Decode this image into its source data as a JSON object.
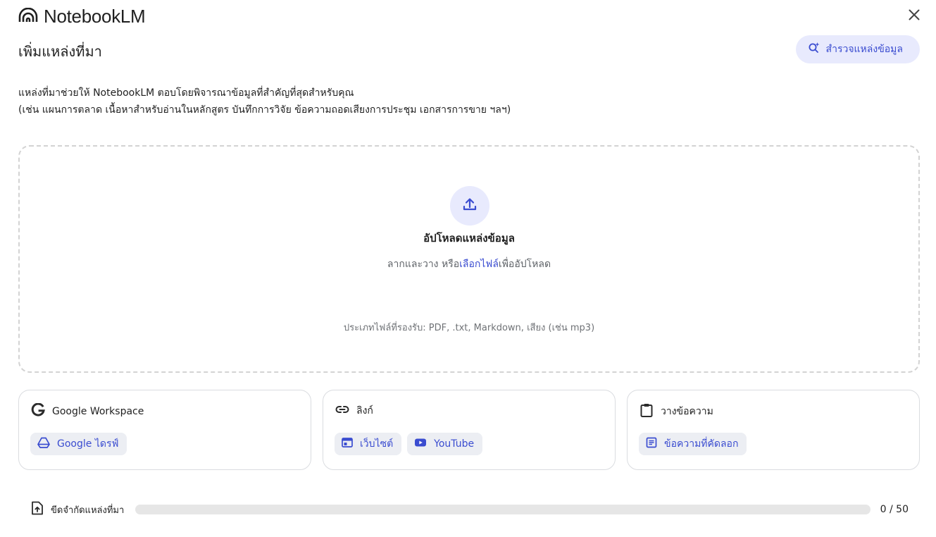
{
  "header": {
    "app_name": "NotebookLM",
    "title": "เพิ่มแหล่งที่มา",
    "explore_label": "สำรวจแหล่งข้อมูล"
  },
  "description": {
    "line1": "แหล่งที่มาช่วยให้ NotebookLM ตอบโดยพิจารณาข้อมูลที่สำคัญที่สุดสำหรับคุณ",
    "line2": "(เช่น แผนการตลาด เนื้อหาสำหรับอ่านในหลักสูตร บันทึกการวิจัย ข้อความถอดเสียงการประชุม เอกสารการขาย ฯลฯ)"
  },
  "upload": {
    "title": "อัปโหลดแหล่งข้อมูล",
    "drag_text": "ลากและวาง หรือ",
    "choose_link": "เลือกไฟล์",
    "after_link": "เพื่ออัปโหลด",
    "supported": "ประเภทไฟล์ที่รองรับ: PDF, .txt, Markdown, เสียง (เช่น mp3)"
  },
  "cards": {
    "workspace": {
      "title": "Google Workspace",
      "chips": [
        "Google ไดรฟ์"
      ]
    },
    "link": {
      "title": "ลิงก์",
      "chips": [
        "เว็บไซต์",
        "YouTube"
      ]
    },
    "paste": {
      "title": "วางข้อความ",
      "chips": [
        "ข้อความที่คัดลอก"
      ]
    }
  },
  "footer": {
    "limit_label": "ขีดจำกัดแหล่งที่มา",
    "count": "0 / 50",
    "progress": 0
  },
  "icons": {
    "logo": "notebooklm-logo-icon",
    "close": "close-icon",
    "explore": "search-spark-icon",
    "upload": "upload-icon",
    "google": "google-g-icon",
    "drive": "drive-icon",
    "link": "link-icon",
    "website": "web-icon",
    "youtube": "youtube-icon",
    "clipboard": "clipboard-icon",
    "document": "document-icon",
    "limit": "file-upload-icon"
  },
  "colors": {
    "accent": "#3a4cd0",
    "accent_bg": "#e8eafd"
  }
}
